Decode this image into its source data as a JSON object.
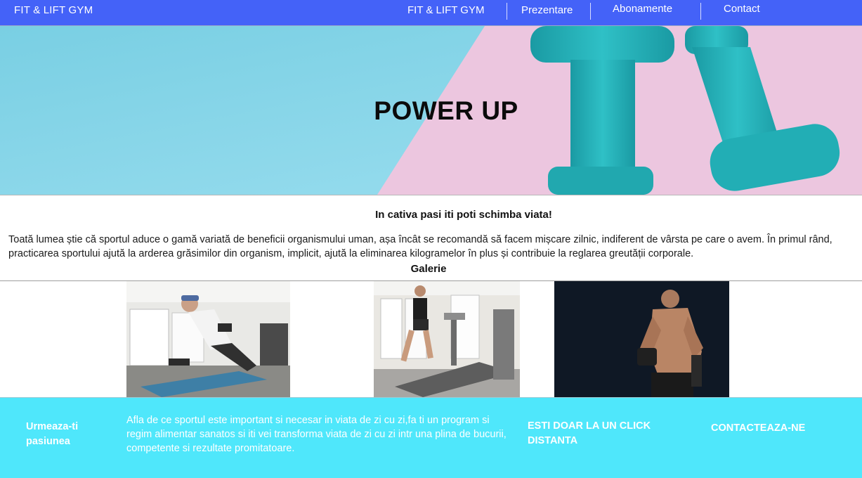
{
  "navbar": {
    "brand": "FIT & LIFT GYM",
    "items": [
      {
        "label": "FIT & LIFT GYM"
      },
      {
        "label": "Prezentare"
      },
      {
        "label": "Abonamente"
      },
      {
        "label": "Contact"
      }
    ],
    "background_color": "#4462f8"
  },
  "hero": {
    "title": "POWER UP"
  },
  "intro": {
    "heading": "In cativa pasi iti poti schimba viata!",
    "paragraph_1": "Toată lumea știe că sportul aduce o gamă variată de beneficii organismului uman, așa încât se recomandă să facem mișcare zilnic, indiferent de vârsta pe care o avem.",
    "paragraph_2": "În primul rând, practicarea sportului ajută la arderea grăsimilor din organism, implicit, ajută la eliminarea kilogramelor în plus și contribuie la reglarea greutății corporale."
  },
  "gallery": {
    "heading": "Galerie",
    "photos": [
      {
        "icon": "man-dumbbell-plank-photo"
      },
      {
        "icon": "woman-treadmill-photo"
      },
      {
        "icon": "bodybuilder-dumbbell-photo"
      }
    ]
  },
  "footer": {
    "tagline": "Urmeaza-ti pasiunea",
    "description": "Afla de ce sportul este important si necesar in viata de zi cu zi,fa ti un program si regim alimentar sanatos si iti vei transforma viata de zi cu zi intr una plina de bucurii, competente si rezultate promitatoare.",
    "click_cta": "ESTI DOAR LA UN CLICK DISTANTA",
    "contact_cta": "CONTACTEAZA-NE",
    "background_color": "#4fe7fb"
  }
}
